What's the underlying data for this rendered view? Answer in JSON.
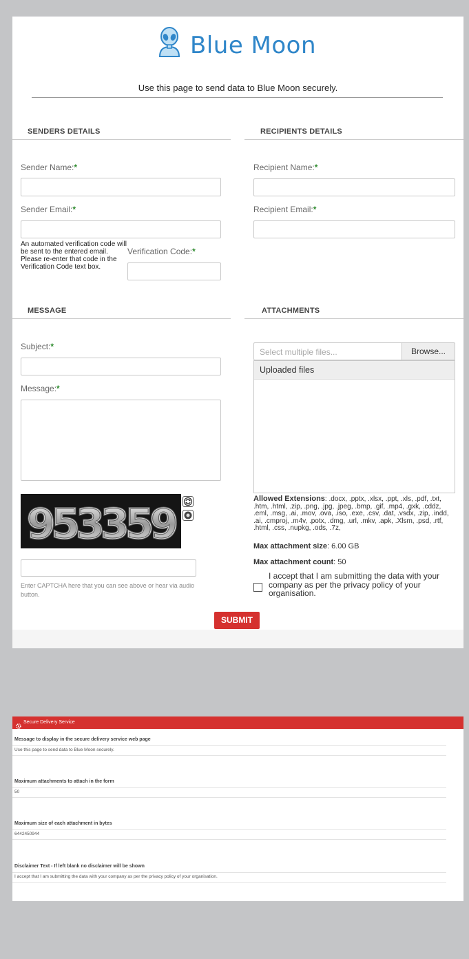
{
  "brand": {
    "name": "Blue Moon"
  },
  "intro_text": "Use this page to send data to Blue Moon securely.",
  "senders": {
    "heading": "SENDERS DETAILS",
    "name_label": "Sender Name:",
    "email_label": "Sender Email:",
    "verification_help": "An automated verification code will be sent to the entered email. Please re-enter that code in the Verification Code text box.",
    "verification_label": "Verification Code:"
  },
  "recipients": {
    "heading": "RECIPIENTS DETAILS",
    "name_label": "Recipient Name:",
    "email_label": "Recipient Email:"
  },
  "required_marker": "*",
  "message": {
    "heading": "MESSAGE",
    "subject_label": "Subject:",
    "message_label": "Message:"
  },
  "captcha": {
    "code": "953359",
    "help": "Enter CAPTCHA here that you can see above or hear via audio button."
  },
  "attachments": {
    "heading": "ATTACHMENTS",
    "select_placeholder": "Select multiple files...",
    "browse_label": "Browse...",
    "uploaded_header": "Uploaded files",
    "allowed_label": "Allowed Extensions",
    "allowed_list": ": .docx, .pptx, .xlsx, .ppt, .xls, .pdf, .txt, .htm, .html, .zip, .png, .jpg, .jpeg, .bmp, .gif, .mp4, .gxk, .cddz, .eml, .msg, .ai, .mov, .ova, .iso, .exe, .csv, .dat, .vsdx, .zip, .indd, .ai, .cmproj, .m4v, .potx, .dmg, .url, .mkv, .apk, .Xlsm, .psd, .rtf, .html, .css, .nupkg, .ods, .7z,",
    "max_size_label": "Max attachment size",
    "max_size_value": ": 6.00 GB",
    "max_count_label": "Max attachment count",
    "max_count_value": ": 50"
  },
  "disclaimer": "I accept that I am submitting the data with your company as per the privacy policy of your organisation.",
  "submit_label": "SUBMIT",
  "admin": {
    "title": "Secure Delivery Service",
    "fields": [
      {
        "label": "Message to display in the secure delivery service web page",
        "value": "Use this page to send data to Blue Moon securely."
      },
      {
        "label": "Maximum attachments to attach in the form",
        "value": "50"
      },
      {
        "label": "Maximum size of each attachment in bytes",
        "value": "6442450944"
      },
      {
        "label": "Disclaimer Text - If left blank no disclaimer will be shown",
        "value": "I accept that I am submitting the data with your company as per the privacy policy of your organisation."
      }
    ]
  },
  "colors": {
    "accent_red": "#d5312f",
    "brand_blue": "#2f86c9",
    "required_green": "#2e8b2e"
  }
}
